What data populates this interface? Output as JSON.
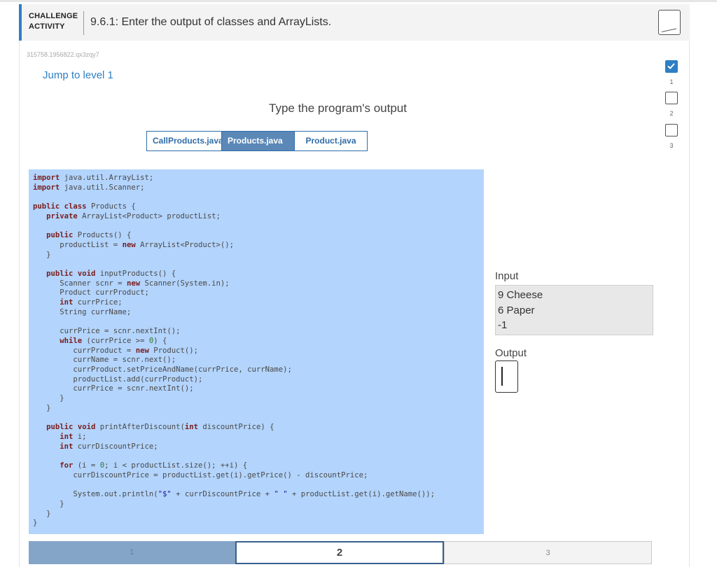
{
  "header": {
    "kicker_line1": "CHALLENGE",
    "kicker_line2": "ACTIVITY",
    "title": "9.6.1: Enter the output of classes and ArrayLists."
  },
  "activity_id": "315758.1956822.qx3zqy7",
  "jump_link": "Jump to level 1",
  "prompt": "Type the program's output",
  "tabs": [
    {
      "label": "CallProducts.java",
      "active": false
    },
    {
      "label": "Products.java",
      "active": true
    },
    {
      "label": "Product.java",
      "active": false
    }
  ],
  "code": "",
  "code_lines": [
    "import java.util.ArrayList;",
    "import java.util.Scanner;",
    "",
    "public class Products {",
    "   private ArrayList<Product> productList;",
    "",
    "   public Products() {",
    "      productList = new ArrayList<Product>();",
    "   }",
    "",
    "   public void inputProducts() {",
    "      Scanner scnr = new Scanner(System.in);",
    "      Product currProduct;",
    "      int currPrice;",
    "      String currName;",
    "",
    "      currPrice = scnr.nextInt();",
    "      while (currPrice >= 0) {",
    "         currProduct = new Product();",
    "         currName = scnr.next();",
    "         currProduct.setPriceAndName(currPrice, currName);",
    "         productList.add(currProduct);",
    "         currPrice = scnr.nextInt();",
    "      }",
    "   }",
    "",
    "   public void printAfterDiscount(int discountPrice) {",
    "      int i;",
    "      int currDiscountPrice;",
    "",
    "      for (i = 0; i < productList.size(); ++i) {",
    "         currDiscountPrice = productList.get(i).getPrice() - discountPrice;",
    "",
    "         System.out.println(\"$\" + currDiscountPrice + \" \" + productList.get(i).getName());",
    "      }",
    "   }",
    "}"
  ],
  "input": {
    "label": "Input",
    "lines": [
      "9 Cheese",
      "6 Paper",
      "-1"
    ]
  },
  "output": {
    "label": "Output",
    "value": ""
  },
  "levels": [
    {
      "label": "1",
      "state": "completed"
    },
    {
      "label": "2",
      "state": "current"
    },
    {
      "label": "3",
      "state": "locked"
    }
  ],
  "sidebar_levels": [
    {
      "number": "1",
      "done": true
    },
    {
      "number": "2",
      "done": false
    },
    {
      "number": "3",
      "done": false
    }
  ],
  "colors": {
    "accent": "#2f7fc4",
    "code_highlight": "#b3d4fc",
    "level_completed": "#84a5c8"
  }
}
